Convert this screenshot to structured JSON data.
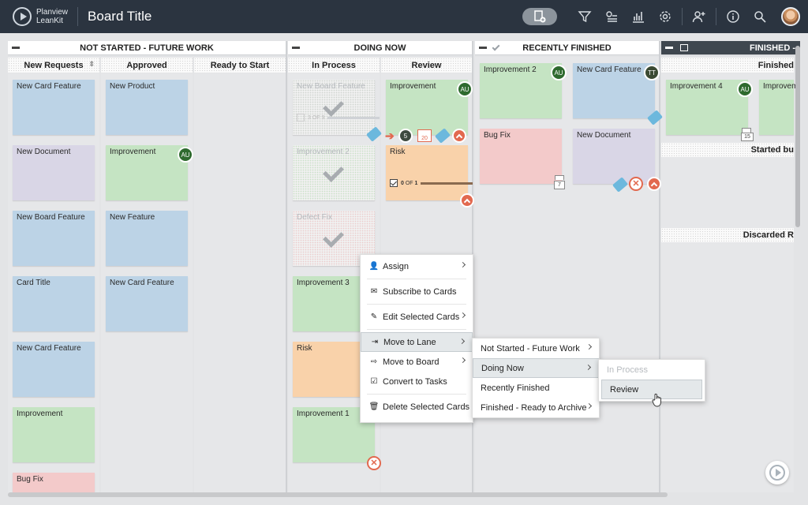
{
  "app": {
    "logo_line1": "Planview",
    "logo_line2": "LeanKit",
    "board_title": "Board Title"
  },
  "toolbar_icons": [
    "new-card-icon",
    "filter-icon",
    "options-icon",
    "analytics-icon",
    "settings-icon",
    "add-user-icon",
    "info-icon",
    "search-icon",
    "user-avatar"
  ],
  "lanes": {
    "not_started": "NOT STARTED - FUTURE WORK",
    "doing_now": "DOING NOW",
    "recently_finished": "RECENTLY FINISHED",
    "finished": "FINISHED -"
  },
  "columns": {
    "new_requests": "New Requests",
    "approved": "Approved",
    "ready_to_start": "Ready to Start",
    "in_process": "In Process",
    "review": "Review",
    "finished_sub": "Finished",
    "started_bu": "Started bu",
    "discarded": "Discarded R"
  },
  "cards": {
    "nr": [
      "New Card Feature",
      "New Document",
      "New Board Feature",
      "Card Title",
      "New Card Feature",
      "Improvement",
      "Bug Fix"
    ],
    "ap": [
      "New Product",
      "Improvement",
      "New Feature",
      "New Card Feature"
    ],
    "ip": [
      "New Board Feature",
      "Improvement 2",
      "Defect Fix",
      "Improvement 3",
      "Risk",
      "Improvement 1"
    ],
    "rv": [
      "Improvement",
      "Risk"
    ],
    "rf": [
      "Improvement 2",
      "New Card Feature",
      "Bug Fix",
      "New Document"
    ],
    "fn": [
      "Improvement 4",
      "Improvem"
    ]
  },
  "badges": {
    "au": "AU",
    "tt": "TT",
    "count5": "5",
    "cal_20": "20",
    "num_7": "7",
    "num_15": "15"
  },
  "progress": {
    "done": "0",
    "of": "OF",
    "total": "1",
    "mini_done": "3",
    "mini_of": "OF",
    "mini_total": "9"
  },
  "context_menu": {
    "items": [
      "Assign",
      "Subscribe to Cards",
      "Edit Selected Cards",
      "Move to Lane",
      "Move to Board",
      "Convert to Tasks",
      "Delete Selected Cards"
    ]
  },
  "lane_submenu": {
    "items": [
      "Not Started - Future Work",
      "Doing Now",
      "Recently Finished",
      "Finished - Ready to Archive"
    ]
  },
  "column_submenu": {
    "items": [
      "In Process",
      "Review"
    ]
  },
  "colors": {
    "topbar": "#2b3440",
    "card_blue": "#bcd3e6",
    "card_green": "#c5e4c3",
    "card_red": "#f3caca",
    "card_orange": "#f9d2aa",
    "accent_red": "#e2694f"
  }
}
